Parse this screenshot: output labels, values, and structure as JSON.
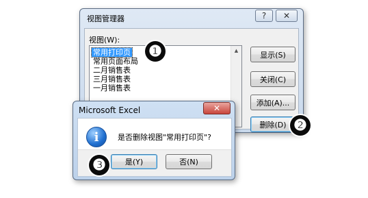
{
  "view_manager": {
    "title": "视图管理器",
    "help_glyph": "?",
    "close_glyph": "✕",
    "views_label": "视图(W):",
    "views": [
      "常用打印页",
      "常用页面布局",
      "二月销售表",
      "三月销售表",
      "一月销售表"
    ],
    "selected_index": 0,
    "buttons": {
      "show": "显示(S)",
      "close": "关闭(C)",
      "add": "添加(A)...",
      "delete": "删除(D)"
    }
  },
  "confirm_dialog": {
    "title": "Microsoft Excel",
    "close_glyph": "✕",
    "icon": "info-icon",
    "icon_glyph": "i",
    "message": "是否删除视图\"常用打印页\"?",
    "yes_label": "是(Y)",
    "no_label": "否(N)"
  },
  "step_badges": [
    "❶",
    "❷",
    "❸"
  ],
  "colors": {
    "selection": "#3399ff",
    "close_button": "#c9463d",
    "badge": "#0b0b0b"
  }
}
